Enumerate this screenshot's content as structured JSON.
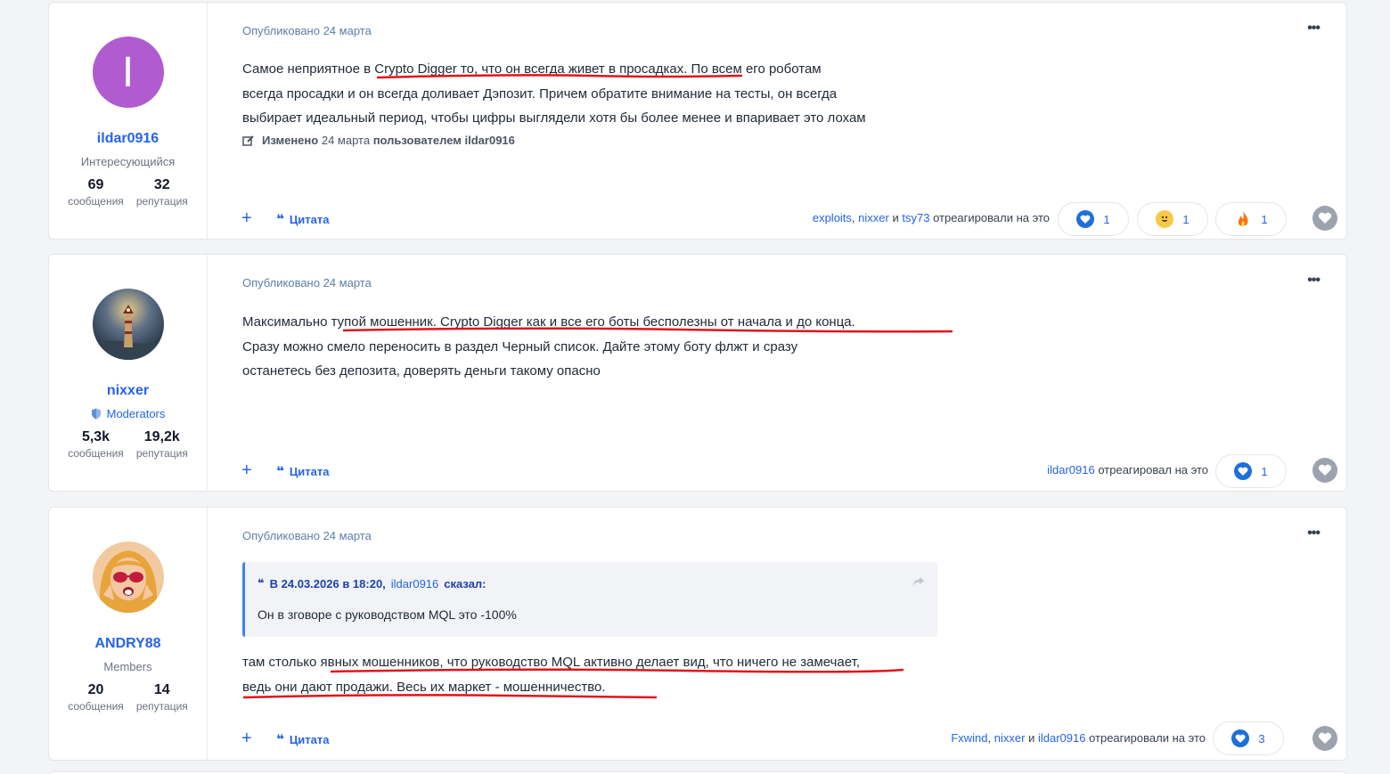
{
  "posts": [
    {
      "author": {
        "name": "ildar0916",
        "role": "Интересующийся",
        "avatar_letter": "I",
        "messages": "69",
        "messages_label": "сообщения",
        "reputation": "32",
        "reputation_label": "репутация"
      },
      "posted": "Опубликовано 24 марта",
      "text_lines": [
        "Самое неприятное в Crypto Digger то, что он всегда живет в просадках. По всем его роботам",
        "всегда просадки и он всегда доливает Дэпозит. Причем обратите внимание на тесты, он всегда",
        "выбирает идеальный период, чтобы цифры выглядели хотя бы более менее и впаривает это лохам"
      ],
      "edited": {
        "label": "Изменено",
        "date": "24 марта",
        "by": "пользователем ildar0916"
      },
      "quote_label": "Цитата",
      "reactors": [
        "exploits",
        ",",
        "nixxer",
        "и",
        "tsy73"
      ],
      "reacted_text": "отреагировали на это",
      "reactions": [
        {
          "icon": "heart-reaction-icon",
          "count": "1"
        },
        {
          "icon": "laugh-reaction-icon",
          "count": "1"
        },
        {
          "icon": "fire-reaction-icon",
          "count": "1"
        }
      ]
    },
    {
      "author": {
        "name": "nixxer",
        "role": "Moderators",
        "messages": "5,3k",
        "messages_label": "сообщения",
        "reputation": "19,2k",
        "reputation_label": "репутация"
      },
      "posted": "Опубликовано 24 марта",
      "text_lines": [
        "Максимально тупой мошенник. Crypto Digger как и все его боты бесполезны от начала и до конца.",
        "Сразу можно смело переносить в раздел Черный список. Дайте этому боту флжт и сразу",
        "останетесь без депозита, доверять деньги такому опасно"
      ],
      "quote_label": "Цитата",
      "reactors": [
        "ildar0916"
      ],
      "reacted_text": "отреагировал на это",
      "reactions": [
        {
          "icon": "heart-reaction-icon",
          "count": "1"
        }
      ]
    },
    {
      "author": {
        "name": "ANDRY88",
        "role": "Members",
        "messages": "20",
        "messages_label": "сообщения",
        "reputation": "14",
        "reputation_label": "репутация"
      },
      "posted": "Опубликовано 24 марта",
      "quote": {
        "prefix": "В 24.03.2026 в 18:20,",
        "user": "ildar0916",
        "suffix": "сказал:",
        "text": "Он в зговоре с руководством MQL это -100%"
      },
      "text_lines": [
        "там столько явных мошенников, что руководство MQL активно делает вид, что ничего не замечает,",
        "ведь они дают продажи. Весь их маркет - мошенничество."
      ],
      "quote_label": "Цитата",
      "reactors": [
        "Fxwind",
        ",",
        "nixxer",
        "и",
        "ildar0916"
      ],
      "reacted_text": "отреагировали на это",
      "reactions": [
        {
          "icon": "heart-reaction-icon",
          "count": "3"
        }
      ]
    }
  ],
  "colors": {
    "accent": "#2563eb",
    "underline": "#e0141c",
    "avatar_purple": "#b05bd0"
  }
}
